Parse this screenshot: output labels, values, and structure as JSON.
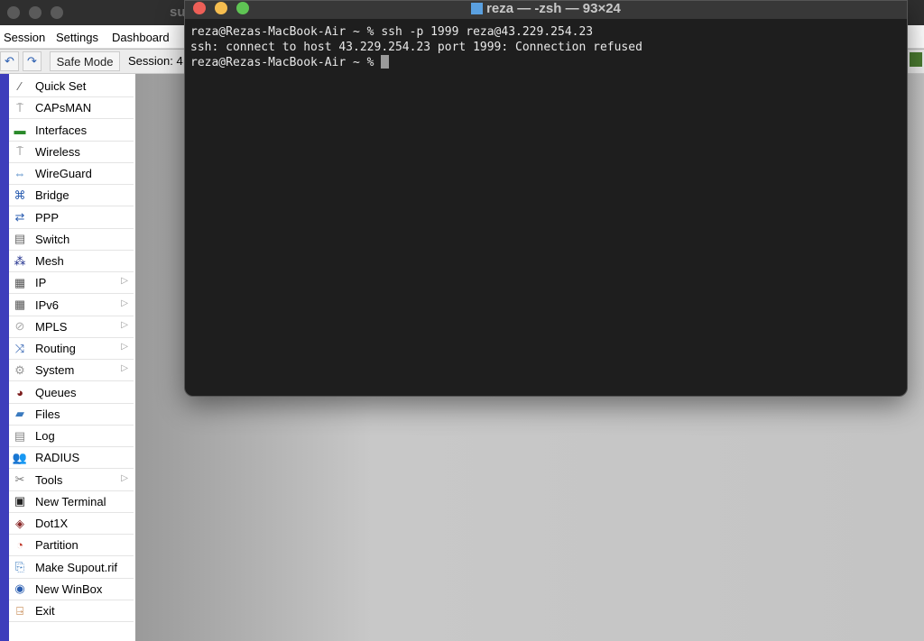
{
  "winbox": {
    "title_fragment": "su",
    "menu": [
      "Session",
      "Settings",
      "Dashboard"
    ],
    "toolbar": {
      "undo": "↶",
      "redo": "↷",
      "safe_mode": "Safe Mode",
      "session_label": "Session: 4"
    }
  },
  "sidebar": {
    "items": [
      {
        "label": "Quick Set",
        "icon": "wand-icon",
        "glyph": "⁄",
        "color": "#555",
        "arrow": false
      },
      {
        "label": "CAPsMAN",
        "icon": "antenna-icon",
        "glyph": "⍑",
        "color": "#777",
        "arrow": false
      },
      {
        "label": "Interfaces",
        "icon": "interfaces-icon",
        "glyph": "▬",
        "color": "#2a8a2a",
        "arrow": false
      },
      {
        "label": "Wireless",
        "icon": "wireless-icon",
        "glyph": "⍑",
        "color": "#777",
        "arrow": false
      },
      {
        "label": "WireGuard",
        "icon": "wireguard-icon",
        "glyph": "⇔",
        "color": "#3a7abf",
        "arrow": false
      },
      {
        "label": "Bridge",
        "icon": "bridge-icon",
        "glyph": "⌘",
        "color": "#2a5db0",
        "arrow": false
      },
      {
        "label": "PPP",
        "icon": "ppp-icon",
        "glyph": "⇄",
        "color": "#2a5db0",
        "arrow": false
      },
      {
        "label": "Switch",
        "icon": "switch-icon",
        "glyph": "▤",
        "color": "#666",
        "arrow": false
      },
      {
        "label": "Mesh",
        "icon": "mesh-icon",
        "glyph": "⁂",
        "color": "#1a2a8a",
        "arrow": false
      },
      {
        "label": "IP",
        "icon": "ip-icon",
        "glyph": "▦",
        "color": "#555",
        "arrow": true
      },
      {
        "label": "IPv6",
        "icon": "ipv6-icon",
        "glyph": "▦",
        "color": "#555",
        "arrow": true
      },
      {
        "label": "MPLS",
        "icon": "mpls-icon",
        "glyph": "⊘",
        "color": "#aaa",
        "arrow": true
      },
      {
        "label": "Routing",
        "icon": "routing-icon",
        "glyph": "⤨",
        "color": "#2a5db0",
        "arrow": true
      },
      {
        "label": "System",
        "icon": "gear-icon",
        "glyph": "⚙",
        "color": "#999",
        "arrow": true
      },
      {
        "label": "Queues",
        "icon": "queues-icon",
        "glyph": "◕",
        "color": "#7a1a1a",
        "arrow": false
      },
      {
        "label": "Files",
        "icon": "folder-icon",
        "glyph": "▰",
        "color": "#3a7abf",
        "arrow": false
      },
      {
        "label": "Log",
        "icon": "log-icon",
        "glyph": "▤",
        "color": "#888",
        "arrow": false
      },
      {
        "label": "RADIUS",
        "icon": "radius-icon",
        "glyph": "👥",
        "color": "#3a7abf",
        "arrow": false
      },
      {
        "label": "Tools",
        "icon": "tools-icon",
        "glyph": "✂",
        "color": "#777",
        "arrow": true
      },
      {
        "label": "New Terminal",
        "icon": "terminal-icon",
        "glyph": "▣",
        "color": "#222",
        "arrow": false
      },
      {
        "label": "Dot1X",
        "icon": "dot1x-icon",
        "glyph": "◈",
        "color": "#8a2a2a",
        "arrow": false
      },
      {
        "label": "Partition",
        "icon": "partition-icon",
        "glyph": "◔",
        "color": "#c0392b",
        "arrow": false
      },
      {
        "label": "Make Supout.rif",
        "icon": "supout-icon",
        "glyph": "⎘",
        "color": "#3a7abf",
        "arrow": false
      },
      {
        "label": "New WinBox",
        "icon": "winbox-icon",
        "glyph": "◉",
        "color": "#2a5db0",
        "arrow": false
      },
      {
        "label": "Exit",
        "icon": "exit-icon",
        "glyph": "⍈",
        "color": "#b5651d",
        "arrow": false
      }
    ]
  },
  "terminal": {
    "title": "reza — -zsh — 93×24",
    "lines": [
      "reza@Rezas-MacBook-Air ~ % ssh -p 1999 reza@43.229.254.23",
      "ssh: connect to host 43.229.254.23 port 1999: Connection refused"
    ],
    "prompt": "reza@Rezas-MacBook-Air ~ % "
  }
}
